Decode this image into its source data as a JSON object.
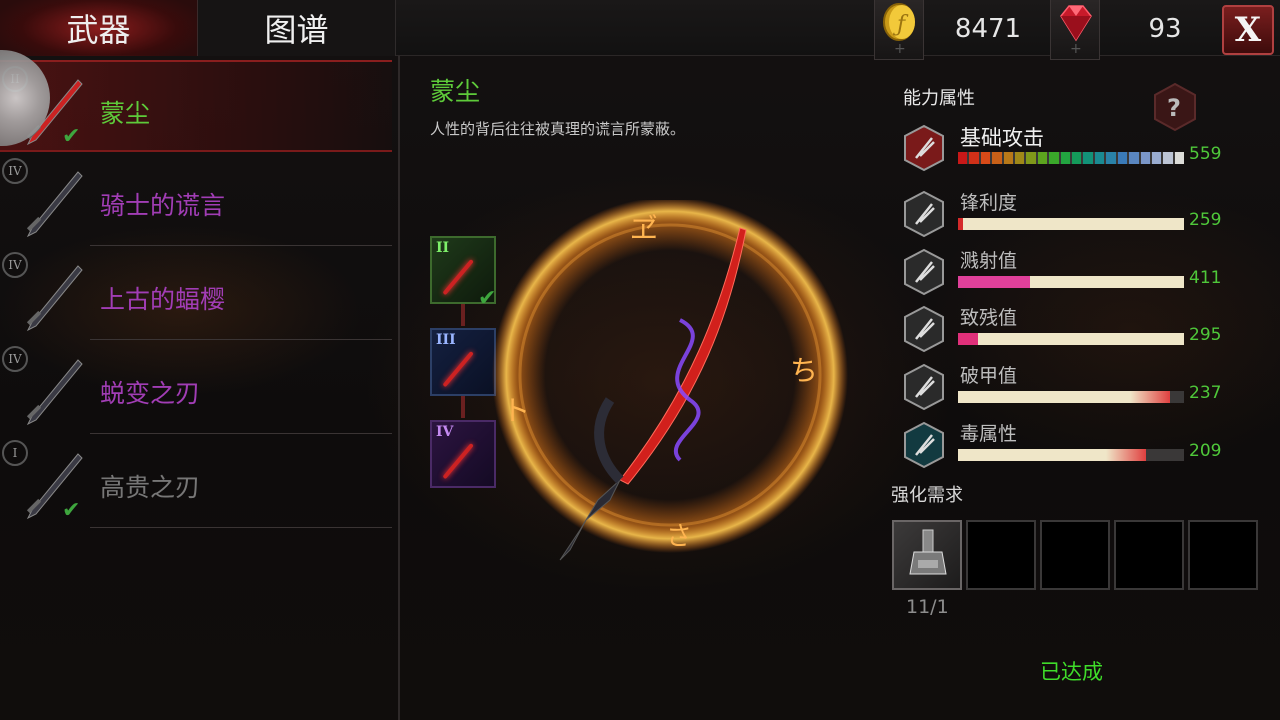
{
  "tabs": {
    "weapons": "武器",
    "codex": "图谱"
  },
  "currency": {
    "coins": "8471",
    "gems": "93",
    "coin_icon": "gold-coin-icon",
    "gem_icon": "red-gem-icon"
  },
  "close_label": "X",
  "weapon_list": [
    {
      "name": "蒙尘",
      "tier": "II",
      "color": "#5ecb3a",
      "equipped": true
    },
    {
      "name": "骑士的谎言",
      "tier": "IV",
      "color": "#a13db5",
      "equipped": false
    },
    {
      "name": "上古的蝠樱",
      "tier": "IV",
      "color": "#a13db5",
      "equipped": false
    },
    {
      "name": "蜕变之刃",
      "tier": "IV",
      "color": "#a13db5",
      "equipped": false
    },
    {
      "name": "高贵之刃",
      "tier": "I",
      "color": "#777777",
      "equipped": true
    }
  ],
  "detail": {
    "title": "蒙尘",
    "description": "人性的背后往往被真理的谎言所蒙蔽。",
    "upgrade_tiers": [
      "II",
      "III",
      "IV"
    ]
  },
  "stats": {
    "title": "能力属性",
    "items": [
      {
        "label": "基础攻击",
        "value": "559",
        "fill": 1.0,
        "color": "rainbow",
        "icon": "attack-icon"
      },
      {
        "label": "锋利度",
        "value": "259",
        "fill": 0.02,
        "color": "#d42a2a",
        "icon": "sharpness-icon"
      },
      {
        "label": "溅射值",
        "value": "411",
        "fill": 0.32,
        "color": "#e0409a",
        "icon": "splash-icon"
      },
      {
        "label": "致残值",
        "value": "295",
        "fill": 0.09,
        "color": "#e0307a",
        "icon": "cripple-icon"
      },
      {
        "label": "破甲值",
        "value": "237",
        "fill": 0.94,
        "color": "#e04040",
        "icon": "armor-break-icon"
      },
      {
        "label": "毒属性",
        "value": "209",
        "fill": 0.83,
        "color": "#e04040",
        "icon": "poison-skull-icon"
      }
    ]
  },
  "requirements": {
    "title": "强化需求",
    "item_count": "11/1",
    "status": "已达成"
  }
}
